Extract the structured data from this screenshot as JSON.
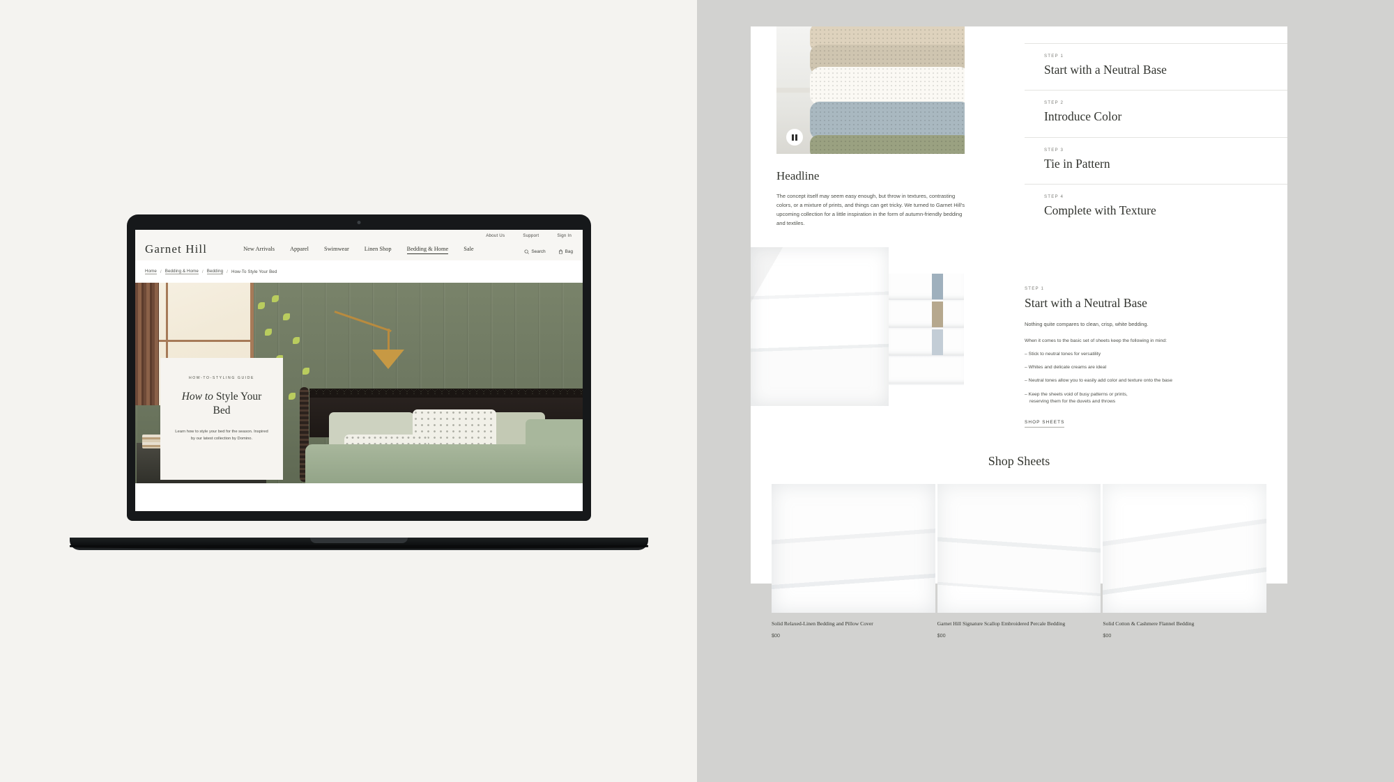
{
  "site": {
    "brand": "Garnet Hill",
    "util_nav": [
      "About Us",
      "Support",
      "Sign In"
    ],
    "main_nav": [
      "New Arrivals",
      "Apparel",
      "Swimwear",
      "Linen Shop",
      "Bedding & Home",
      "Sale"
    ],
    "active_nav": "Bedding & Home",
    "search_label": "Search",
    "bag_label": "Bag",
    "breadcrumb": [
      "Home",
      "Bedding & Home",
      "Bedding",
      "How-To Style Your Bed"
    ]
  },
  "hero": {
    "eyebrow": "HOW-TO-STYLING GUIDE",
    "title_italic": "How to",
    "title_rest": " Style Your Bed",
    "subtitle": "Learn how to style your bed for the season. Inspired by our latest collection by Domino."
  },
  "article": {
    "video": {
      "pause_icon": "pause-icon"
    },
    "headline": "Headline",
    "body": "The concept itself may seem easy enough, but throw in textures, contrasting colors, or a mixture of prints, and things can get tricky. We turned to Garnet Hill's upcoming collection for a little inspiration in the form of autumn-friendly bedding and textiles.",
    "steps": [
      {
        "kicker": "STEP 1",
        "name": "Start with a Neutral Base"
      },
      {
        "kicker": "STEP 2",
        "name": "Introduce Color"
      },
      {
        "kicker": "STEP 3",
        "name": "Tie in Pattern"
      },
      {
        "kicker": "STEP 4",
        "name": "Complete with Texture"
      }
    ]
  },
  "step_one": {
    "kicker": "STEP 1",
    "title": "Start with a Neutral Base",
    "lead": "Nothing quite compares to clean, crisp, white bedding.",
    "intro": "When it comes to the basic set of sheets keep the following in mind:",
    "bullets": [
      {
        "text": "– Stick to neutral tones for versatility",
        "cont": ""
      },
      {
        "text": "– Whites and delicate creams are ideal",
        "cont": ""
      },
      {
        "text": "– Neutral tones allow you to easily add color and texture onto the base",
        "cont": ""
      },
      {
        "text": "– Keep the sheets void of busy patterns or prints,",
        "cont": "reserving them for the duvets and throws"
      }
    ],
    "cta": "SHOP SHEETS"
  },
  "shop": {
    "title": "Shop Sheets",
    "products": [
      {
        "name": "Solid Relaxed-Linen Bedding and Pillow Cover",
        "price": "$00"
      },
      {
        "name": "Garnet Hill Signature Scallop Embroidered Percale Bedding",
        "price": "$00"
      },
      {
        "name": "Solid Cotton & Cashmere Flannel Bedding",
        "price": "$00"
      }
    ]
  },
  "colors": {
    "left_bg": "#f4f3f0",
    "right_bg": "#d2d2d0",
    "sheet": "#ffffff",
    "text": "#33352f",
    "muted": "#7d7e78"
  }
}
